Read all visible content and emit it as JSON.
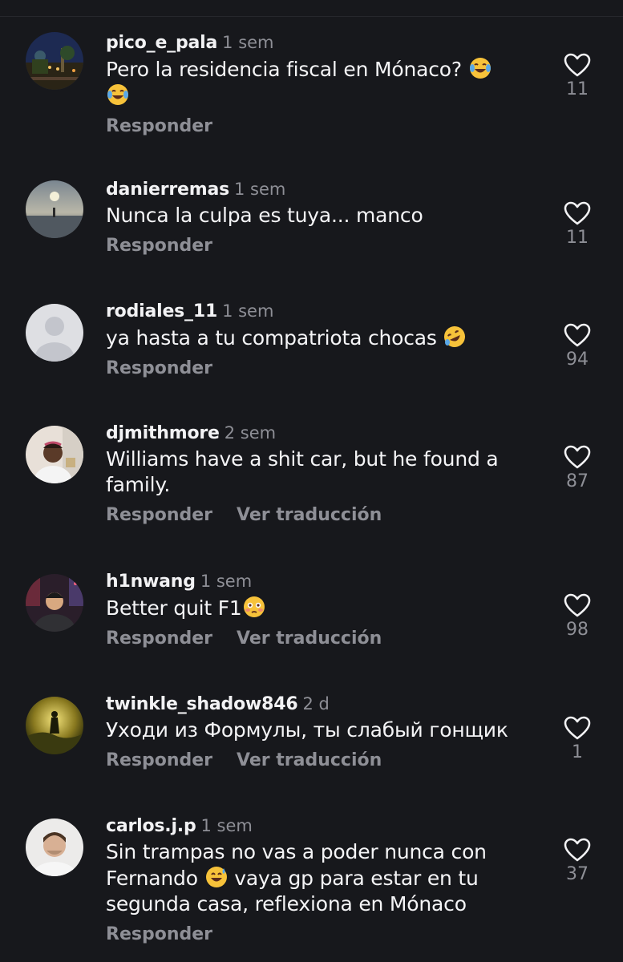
{
  "comments": [
    {
      "username": "pico_e_pala",
      "time": "1 sem",
      "text_lines": [
        "Pero la residencia fiscal en Mónaco? ",
        ""
      ],
      "emojis": [
        "face-with-tears-of-joy",
        "face-with-tears-of-joy"
      ],
      "reply_label": "Responder",
      "translate_label": "",
      "likes": "11"
    },
    {
      "username": "danierremas",
      "time": "1 sem",
      "text_lines": [
        "Nunca la culpa es tuya... manco"
      ],
      "reply_label": "Responder",
      "translate_label": "",
      "likes": "11"
    },
    {
      "username": "rodiales_11",
      "time": "1 sem",
      "text_lines": [
        "ya hasta a tu compatriota chocas "
      ],
      "emojis": [
        "rolling-on-the-floor-laughing"
      ],
      "reply_label": "Responder",
      "translate_label": "",
      "likes": "94"
    },
    {
      "username": "djmithmore",
      "time": "2 sem",
      "text_lines": [
        "Williams have a shit car, but he found a",
        "family."
      ],
      "reply_label": "Responder",
      "translate_label": "Ver traducción",
      "likes": "87"
    },
    {
      "username": "h1nwang",
      "time": "1 sem",
      "text_lines": [
        "Better quit F1"
      ],
      "emojis": [
        "flushed-face"
      ],
      "reply_label": "Responder",
      "translate_label": "Ver traducción",
      "likes": "98"
    },
    {
      "username": "twinkle_shadow846",
      "time": "2 d",
      "text_lines": [
        "Уходи из Формулы, ты слабый гонщик"
      ],
      "reply_label": "Responder",
      "translate_label": "Ver traducción",
      "likes": "1"
    },
    {
      "username": "carlos.j.p",
      "time": "1 sem",
      "text_lines": [
        "Sin trampas no vas a poder nunca con",
        "Fernando ",
        " vaya gp para estar en tu",
        "segunda casa, reflexiona en Mónaco"
      ],
      "emojis": [
        "grinning-face-with-sweat"
      ],
      "reply_label": "Responder",
      "translate_label": "",
      "likes": "37"
    }
  ],
  "colors": {
    "background": "#17181c",
    "text": "#f4f4f6",
    "secondary": "#8e8f96"
  },
  "icons": {
    "like": "heart-outline-icon",
    "emoji_joy": "face-with-tears-of-joy",
    "emoji_rofl": "rolling-on-the-floor-laughing",
    "emoji_flushed": "flushed-face",
    "emoji_sweat": "grinning-face-with-sweat"
  }
}
